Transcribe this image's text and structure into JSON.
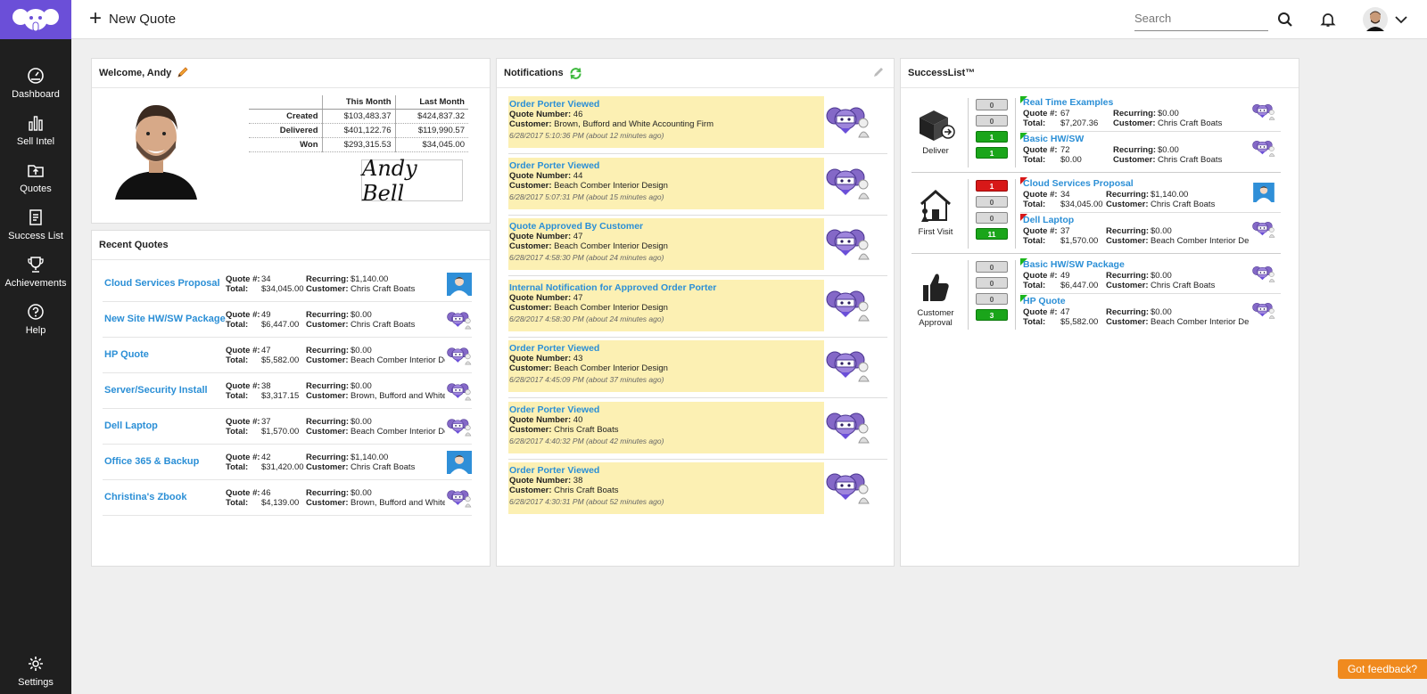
{
  "colors": {
    "brand": "#6b4fd8",
    "link": "#2b8fd6",
    "note_bg": "#fcf0b3",
    "feedback": "#f08a1e"
  },
  "sidebar": {
    "items": [
      {
        "label": "Dashboard",
        "icon": "dashboard-icon"
      },
      {
        "label": "Sell Intel",
        "icon": "bar-chart-icon"
      },
      {
        "label": "Quotes",
        "icon": "quotes-icon"
      },
      {
        "label": "Success List",
        "icon": "checklist-icon"
      },
      {
        "label": "Achievements",
        "icon": "trophy-icon"
      },
      {
        "label": "Help",
        "icon": "help-icon"
      }
    ],
    "settings_label": "Settings"
  },
  "topbar": {
    "new_quote_label": "New Quote",
    "search_placeholder": "Search"
  },
  "welcome": {
    "title": "Welcome, Andy",
    "stats": {
      "headers": [
        "This Month",
        "Last Month"
      ],
      "rows": [
        {
          "label": "Created",
          "this_month": "$103,483.37",
          "last_month": "$424,837.32"
        },
        {
          "label": "Delivered",
          "this_month": "$401,122.76",
          "last_month": "$119,990.57"
        },
        {
          "label": "Won",
          "this_month": "$293,315.53",
          "last_month": "$34,045.00"
        }
      ]
    },
    "signature": "Andy Bell"
  },
  "recent_quotes": {
    "title": "Recent Quotes",
    "labels": {
      "quote": "Quote #:",
      "total": "Total:",
      "recurring": "Recurring:",
      "customer": "Customer:"
    },
    "items": [
      {
        "name": "Cloud Services Proposal",
        "quote": "34",
        "total": "$34,045.00",
        "recurring": "$1,140.00",
        "customer": "Chris Craft Boats",
        "icon": "person-photo-icon"
      },
      {
        "name": "New Site HW/SW Package",
        "quote": "49",
        "total": "$6,447.00",
        "recurring": "$0.00",
        "customer": "Chris Craft Boats",
        "icon": "mascot-icon"
      },
      {
        "name": "HP Quote",
        "quote": "47",
        "total": "$5,582.00",
        "recurring": "$0.00",
        "customer": "Beach Comber Interior Des",
        "icon": "mascot-icon"
      },
      {
        "name": "Server/Security Install",
        "quote": "38",
        "total": "$3,317.15",
        "recurring": "$0.00",
        "customer": "Brown, Bufford and White",
        "icon": "mascot-icon"
      },
      {
        "name": "Dell Laptop",
        "quote": "37",
        "total": "$1,570.00",
        "recurring": "$0.00",
        "customer": "Beach Comber Interior Des",
        "icon": "mascot-icon"
      },
      {
        "name": "Office 365 & Backup",
        "quote": "42",
        "total": "$31,420.00",
        "recurring": "$1,140.00",
        "customer": "Chris Craft Boats",
        "icon": "person-photo-icon"
      },
      {
        "name": "Christina's Zbook",
        "quote": "46",
        "total": "$4,139.00",
        "recurring": "$0.00",
        "customer": "Brown, Bufford and White",
        "icon": "mascot-icon"
      }
    ]
  },
  "notifications": {
    "title": "Notifications",
    "labels": {
      "quote_number": "Quote Number:",
      "customer": "Customer:"
    },
    "items": [
      {
        "title": "Order Porter Viewed",
        "quote_number": "46",
        "customer": "Brown, Bufford and White Accounting Firm",
        "time": "6/28/2017 5:10:36 PM (about 12 minutes ago)"
      },
      {
        "title": "Order Porter Viewed",
        "quote_number": "44",
        "customer": "Beach Comber Interior Design",
        "time": "6/28/2017 5:07:31 PM (about 15 minutes ago)"
      },
      {
        "title": "Quote Approved By Customer",
        "quote_number": "47",
        "customer": "Beach Comber Interior Design",
        "time": "6/28/2017 4:58:30 PM (about 24 minutes ago)"
      },
      {
        "title": "Internal Notification for Approved Order Porter",
        "quote_number": "47",
        "customer": "Beach Comber Interior Design",
        "time": "6/28/2017 4:58:30 PM (about 24 minutes ago)"
      },
      {
        "title": "Order Porter Viewed",
        "quote_number": "43",
        "customer": "Beach Comber Interior Design",
        "time": "6/28/2017 4:45:09 PM (about 37 minutes ago)"
      },
      {
        "title": "Order Porter Viewed",
        "quote_number": "40",
        "customer": "Chris Craft Boats",
        "time": "6/28/2017 4:40:32 PM (about 42 minutes ago)"
      },
      {
        "title": "Order Porter Viewed",
        "quote_number": "38",
        "customer": "Chris Craft Boats",
        "time": "6/28/2017 4:30:31 PM (about 52 minutes ago)"
      }
    ]
  },
  "successlist": {
    "title": "SuccessList™",
    "labels": {
      "quote": "Quote #:",
      "total": "Total:",
      "recurring": "Recurring:",
      "customer": "Customer:"
    },
    "stages": [
      {
        "name": "Deliver",
        "icon": "box-delivery-icon",
        "counts": [
          {
            "value": "0",
            "color": "gray"
          },
          {
            "value": "0",
            "color": "gray"
          },
          {
            "value": "1",
            "color": "green"
          },
          {
            "value": "1",
            "color": "green"
          }
        ],
        "items": [
          {
            "name": "Real Time Examples",
            "quote": "67",
            "total": "$7,207.36",
            "recurring": "$0.00",
            "customer": "Chris Craft Boats",
            "flag": "green",
            "icon": "mascot-icon"
          },
          {
            "name": "Basic HW/SW",
            "quote": "72",
            "total": "$0.00",
            "recurring": "$0.00",
            "customer": "Chris Craft Boats",
            "flag": "green",
            "icon": "mascot-icon"
          }
        ]
      },
      {
        "name": "First Visit",
        "icon": "house-visit-icon",
        "counts": [
          {
            "value": "1",
            "color": "red"
          },
          {
            "value": "0",
            "color": "gray"
          },
          {
            "value": "0",
            "color": "gray"
          },
          {
            "value": "11",
            "color": "green"
          }
        ],
        "items": [
          {
            "name": "Cloud Services Proposal",
            "quote": "34",
            "total": "$34,045.00",
            "recurring": "$1,140.00",
            "customer": "Chris Craft Boats",
            "flag": "red",
            "icon": "person-photo-icon"
          },
          {
            "name": "Dell Laptop",
            "quote": "37",
            "total": "$1,570.00",
            "recurring": "$0.00",
            "customer": "Beach Comber Interior Des",
            "flag": "red",
            "icon": "mascot-icon"
          }
        ]
      },
      {
        "name": "Customer Approval",
        "icon": "thumbs-up-icon",
        "counts": [
          {
            "value": "0",
            "color": "gray"
          },
          {
            "value": "0",
            "color": "gray"
          },
          {
            "value": "0",
            "color": "gray"
          },
          {
            "value": "3",
            "color": "green"
          }
        ],
        "items": [
          {
            "name": "Basic HW/SW Package",
            "quote": "49",
            "total": "$6,447.00",
            "recurring": "$0.00",
            "customer": "Chris Craft Boats",
            "flag": "green",
            "icon": "mascot-icon"
          },
          {
            "name": "HP Quote",
            "quote": "47",
            "total": "$5,582.00",
            "recurring": "$0.00",
            "customer": "Beach Comber Interior Des",
            "flag": "green",
            "icon": "mascot-icon"
          }
        ]
      }
    ]
  },
  "feedback_label": "Got feedback?"
}
